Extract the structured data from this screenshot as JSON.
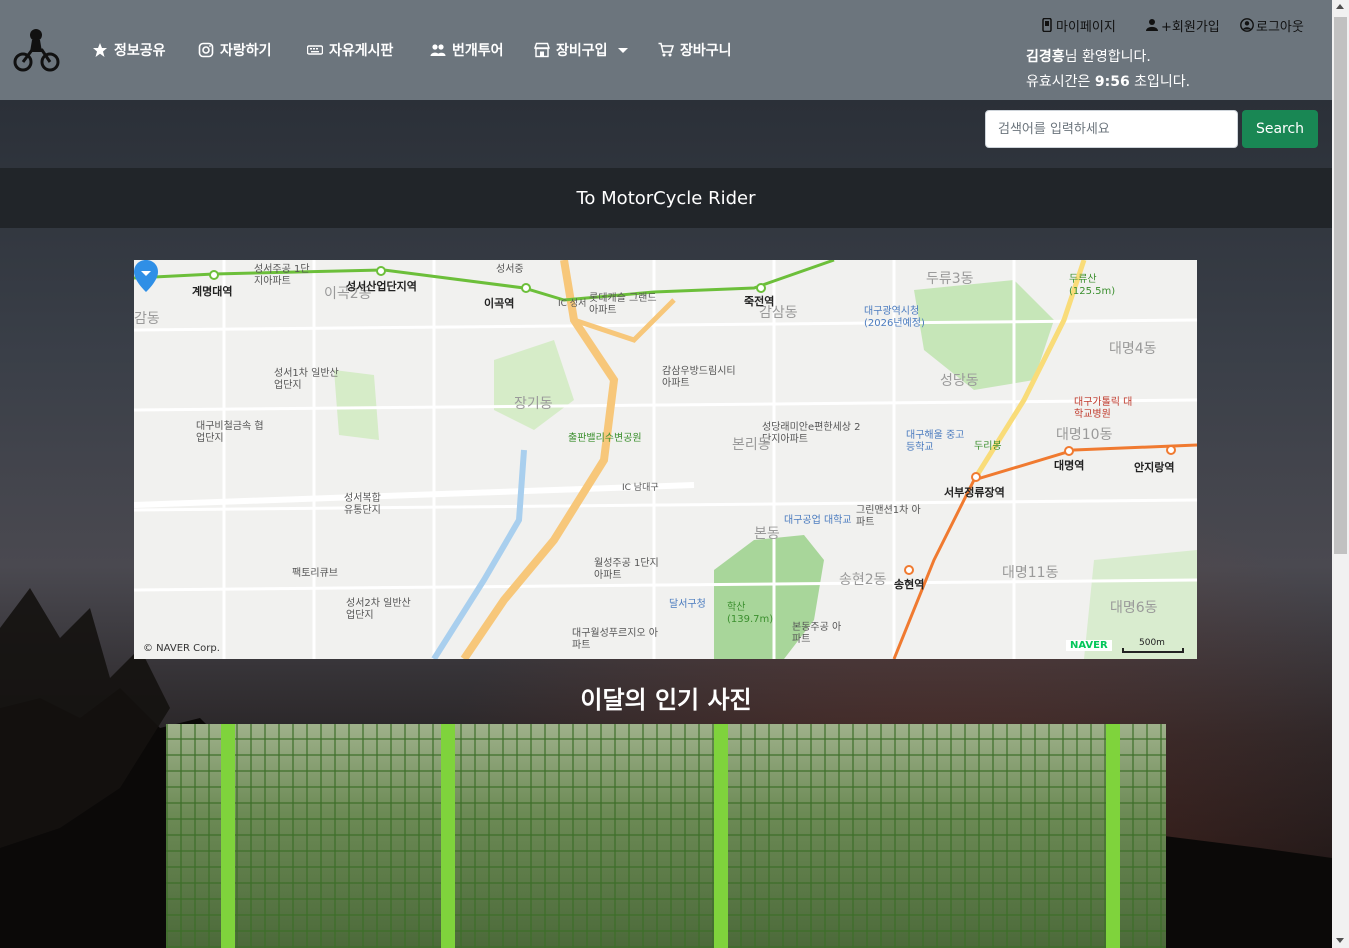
{
  "navbar": {
    "items": [
      {
        "label": "정보공유",
        "icon": "star-icon"
      },
      {
        "label": "자랑하기",
        "icon": "instagram-icon"
      },
      {
        "label": "자유게시판",
        "icon": "keyboard-icon"
      },
      {
        "label": "번개투어",
        "icon": "people-icon"
      },
      {
        "label": "장비구입",
        "icon": "shop-icon",
        "dropdown": true
      },
      {
        "label": "장바구니",
        "icon": "cart-icon"
      }
    ],
    "user_links": {
      "mypage": "마이페이지",
      "signup": "+회원가입",
      "logout": "로그아웃"
    },
    "welcome_name": "김경흥",
    "welcome_suffix": "님 환영합니다.",
    "timer_prefix": "유효시간은 ",
    "timer_value": "9:56",
    "timer_suffix": " 초입니다."
  },
  "search": {
    "placeholder": "검색어를 입력하세요",
    "button": "Search"
  },
  "title": "To MotorCycle Rider",
  "map": {
    "labels": {
      "gyemyeong": "계명대역",
      "seongseo_apt": "성서주공 1단지아파트",
      "seongseo_ind": "성서산업단지역",
      "igok_dong": "이곡2동",
      "igok": "이곡역",
      "ic_seongseo": "IC 성서",
      "lotte": "롯데캐슬 그랜드아파트",
      "jukjeon": "죽전역",
      "gamsam": "감삼동",
      "durue": "두류3동",
      "duru_san": "두류산 (125.5m)",
      "city_hall": "대구광역시청 (2026년예정)",
      "daemyeong4": "대명4동",
      "seongseo1": "성서1차 일반산업단지",
      "gamsam_apt": "감삼우방드림시티 아파트",
      "seongdang": "성당동",
      "janggi": "장기동",
      "daegu_bicheol": "대구비철금속 협업단지",
      "culpan_park": "출판밸리수변공원",
      "seongdang_apt": "성당래미안e편한세상 2단지아파트",
      "daegu_haeul": "대구해울 중고등학교",
      "duri_bong": "두리봉",
      "catholic_hosp": "대구가톨릭 대학교병원",
      "daemyeong10": "대명10동",
      "bonri": "본리동",
      "ic_namdaegu": "IC 남대구",
      "daemyeong_st": "대명역",
      "anjirang": "안지랑역",
      "seobu": "서부정류장역",
      "seongseo_complex": "성서복합 유통단지",
      "techno": "대구공업 대학교",
      "green_apt": "그린맨션1차 아파트",
      "bon_dong": "본동",
      "wolseong_apt": "월성주공 1단지아파트",
      "songhyeon2": "송현2동",
      "songhyeon_st": "송현역",
      "daemyeong11": "대명11동",
      "factory_cube": "팩토리큐브",
      "seongseo2": "성서2차 일반산업단지",
      "dalseo_gu": "달서구청",
      "haksan": "학산 (139.7m)",
      "bon_apt": "본동주공 아파트",
      "daemyeong6": "대명6동",
      "wolseong_apt2": "대구월성푸르지오 아파트",
      "seongseo_ms": "성서중",
      "dong_partial": "감동"
    },
    "credit": "© NAVER Corp.",
    "naver": "NAVER",
    "scale": "500m"
  },
  "popular": {
    "title": "이달의 인기 사진"
  },
  "colors": {
    "navbar_bg": "#6c757d",
    "search_btn": "#198754",
    "title_band": "#212529"
  }
}
